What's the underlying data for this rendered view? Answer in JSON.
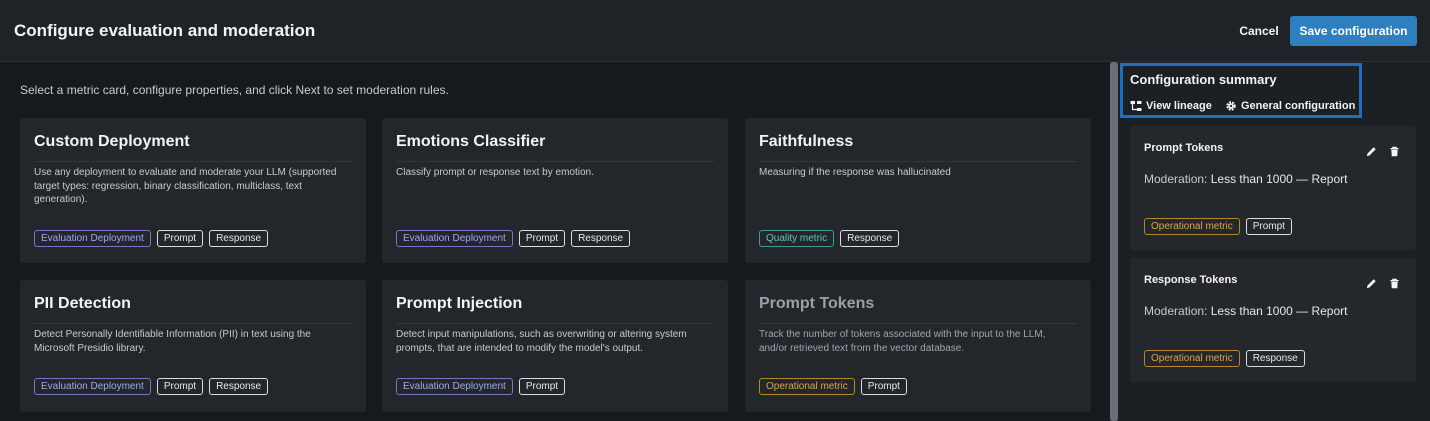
{
  "header": {
    "title": "Configure evaluation and moderation",
    "cancel_label": "Cancel",
    "save_label": "Save configuration"
  },
  "main": {
    "instructions": "Select a metric card, configure properties, and click Next to set moderation rules.",
    "cards": [
      {
        "title": "Custom Deployment",
        "description": "Use any deployment to evaluate and moderate your LLM (supported target types: regression, binary classification, multiclass, text generation).",
        "tags": [
          "Evaluation Deployment",
          "Prompt",
          "Response"
        ]
      },
      {
        "title": "Emotions Classifier",
        "description": "Classify prompt or response text by emotion.",
        "tags": [
          "Evaluation Deployment",
          "Prompt",
          "Response"
        ]
      },
      {
        "title": "Faithfulness",
        "description": "Measuring if the response was hallucinated",
        "tags": [
          "Quality metric",
          "Response"
        ]
      },
      {
        "title": "PII Detection",
        "description": "Detect Personally Identifiable Information (PII) in text using the Microsoft Presidio library.",
        "tags": [
          "Evaluation Deployment",
          "Prompt",
          "Response"
        ]
      },
      {
        "title": "Prompt Injection",
        "description": "Detect input manipulations, such as overwriting or altering system prompts, that are intended to modify the model's output.",
        "tags": [
          "Evaluation Deployment",
          "Prompt"
        ]
      },
      {
        "title": "Prompt Tokens",
        "description": "Track the number of tokens associated with the input to the LLM, and/or retrieved text from the vector database.",
        "tags": [
          "Operational metric",
          "Prompt"
        ]
      }
    ]
  },
  "summary": {
    "title": "Configuration summary",
    "view_lineage": "View lineage",
    "general_configuration": "General configuration",
    "items": [
      {
        "title": "Prompt Tokens",
        "moderation_label": "Moderation:",
        "moderation_value": "Less than 1000 — Report",
        "tags": [
          "Operational metric",
          "Prompt"
        ]
      },
      {
        "title": "Response Tokens",
        "moderation_label": "Moderation:",
        "moderation_value": "Less than 1000 — Report",
        "tags": [
          "Operational metric",
          "Response"
        ]
      }
    ]
  },
  "colors": {
    "accent": "#2e7fc0",
    "highlight_border": "#1f6fc0",
    "evaluation_tag": "#9ea8f0",
    "quality_tag": "#67c3b6",
    "operational_tag": "#e0a446"
  }
}
